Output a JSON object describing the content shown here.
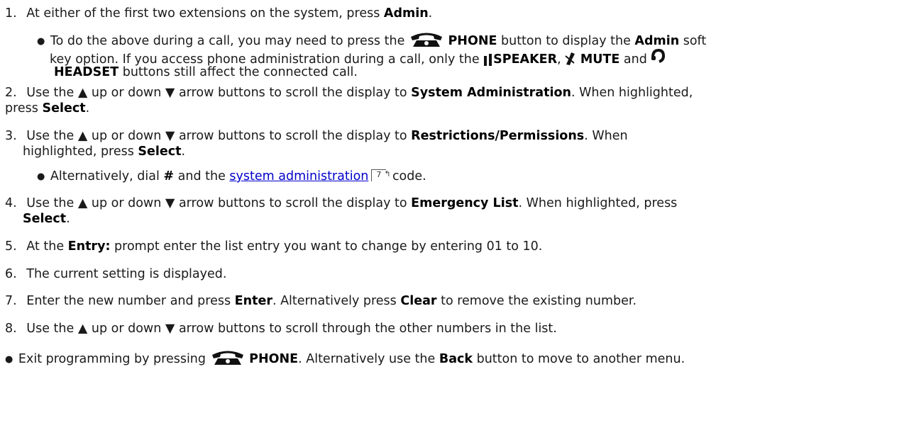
{
  "steps": {
    "s1": {
      "num": "1.",
      "pre": "At either of the first two extensions on the system, press ",
      "b1": "Admin",
      "post": "."
    },
    "s1_sub": {
      "pre": "To do the above during a call, you may need to press the ",
      "b_phone": "PHONE",
      "mid": " button to display the ",
      "b_admin": "Admin",
      "post": " soft",
      "line2_pre": "key option. If you access phone administration during a call, only the ",
      "b_speaker": "SPEAKER",
      "comma": ", ",
      "b_mute": "MUTE",
      "and": " and ",
      "b_headset": "HEADSET",
      "line3_post": " buttons still affect the connected call."
    },
    "s2": {
      "num": "2.",
      "pre": "Use the ",
      "up": "up or down",
      "mid": " arrow buttons to scroll the display to ",
      "b1": "System Administration",
      "post": ". When highlighted,",
      "line2_pre": "press ",
      "b2": "Select",
      "line2_post": "."
    },
    "s3": {
      "num": "3.",
      "pre": "Use the ",
      "up": "up or down",
      "mid": " arrow buttons to scroll the display to ",
      "b1": "Restrictions/Permissions",
      "post": ". When",
      "line2_pre": "highlighted, press ",
      "b2": "Select",
      "line2_post": "."
    },
    "s3_sub": {
      "pre": "Alternatively, dial ",
      "b_hash": "#",
      "mid": " and the ",
      "link": "system administration",
      "pageref": "7",
      "post": " code."
    },
    "s4": {
      "num": "4.",
      "pre": "Use the ",
      "up": "up or down",
      "mid": " arrow buttons to scroll the display to ",
      "b1": "Emergency List",
      "post": ". When highlighted, press",
      "b2": "Select",
      "line2_post": "."
    },
    "s5": {
      "num": "5.",
      "pre": "At the ",
      "b1": "Entry:",
      "post": " prompt enter the list entry you want to change by entering 01 to 10."
    },
    "s6": {
      "num": "6.",
      "text": "The current setting is displayed."
    },
    "s7": {
      "num": "7.",
      "pre": "Enter the new number and press ",
      "b1": "Enter",
      "mid": ". Alternatively press ",
      "b2": "Clear",
      "post": " to remove the existing number."
    },
    "s8": {
      "num": "8.",
      "pre": "Use the ",
      "up": "up or down",
      "post": " arrow buttons to scroll through the other numbers in the list."
    },
    "exit": {
      "pre": "Exit programming by pressing ",
      "b_phone": "PHONE",
      "mid": ". Alternatively use the ",
      "b_back": "Back",
      "post": " button to move to another menu."
    }
  },
  "icons": [
    "phone-icon",
    "speaker-icon",
    "mute-icon",
    "headset-icon",
    "up-arrow-icon",
    "down-arrow-icon",
    "page-reference-icon"
  ]
}
